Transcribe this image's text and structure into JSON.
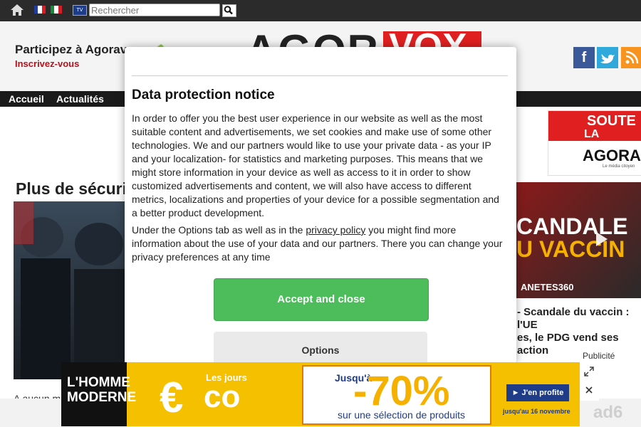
{
  "topbar": {
    "search_placeholder": "Rechercher",
    "tv_label": "TV"
  },
  "header": {
    "participate": "Participez à Agoravox",
    "signup": "Inscrivez-vous",
    "logo_left": "AGORA",
    "logo_right": "VOX"
  },
  "nav": {
    "items": [
      "Accueil",
      "Actualités"
    ]
  },
  "article": {
    "title": "Plus de sécurit",
    "lede": "A aucun m"
  },
  "sidebar": {
    "ad_top_line1": "SOUTE",
    "ad_top_line2": "LA FONDA",
    "ad_top_brand": "AGORA",
    "ad_top_tagline": "Le média citoyen",
    "video_title_line1": "- Scandale du vaccin : l'UE",
    "video_title_line2": "es, le PDG vend ses action",
    "video_overlay_line1": "CANDALE",
    "video_overlay_line2": "U VACCIN",
    "video_channel": "ANETES360",
    "publicite": "Publicité"
  },
  "modal": {
    "title": "Data protection notice",
    "paragraph1": "In order to offer you the best user experience in our website as well as the most suitable content and advertisements, we set cookies and make use of some other technologies. We and our partners would like to use your private data - as your IP and your localization- for statistics and marketing purposes. This means that we might store information in your device as well as access to it in order to show customized advertisements and content, we will also have access to different metrics, localizations and properties of your device for a possible segmentation and a better product development.",
    "paragraph2_before": "Under the Options tab as well as in the ",
    "paragraph2_link": "privacy policy",
    "paragraph2_after": " you might find more information about the use of your data and our partners. There you can change your privacy preferences at any time",
    "accept_label": "Accept and close",
    "options_label": "Options"
  },
  "bottom_ad": {
    "brand": "L'HOMME MODERNE",
    "les_jours": "Les jours",
    "euro": "€",
    "eco": "co",
    "jusqu": "Jusqu'à",
    "percent": "-70%",
    "selection": "sur une sélection de produits",
    "cta": "► J'en profite",
    "date": "jusqu'au 16 novembre",
    "network": "ad6"
  },
  "colors": {
    "accent_red": "#e02020",
    "accept_green": "#4cbd5a",
    "nav_dark": "#1b1b1b"
  }
}
